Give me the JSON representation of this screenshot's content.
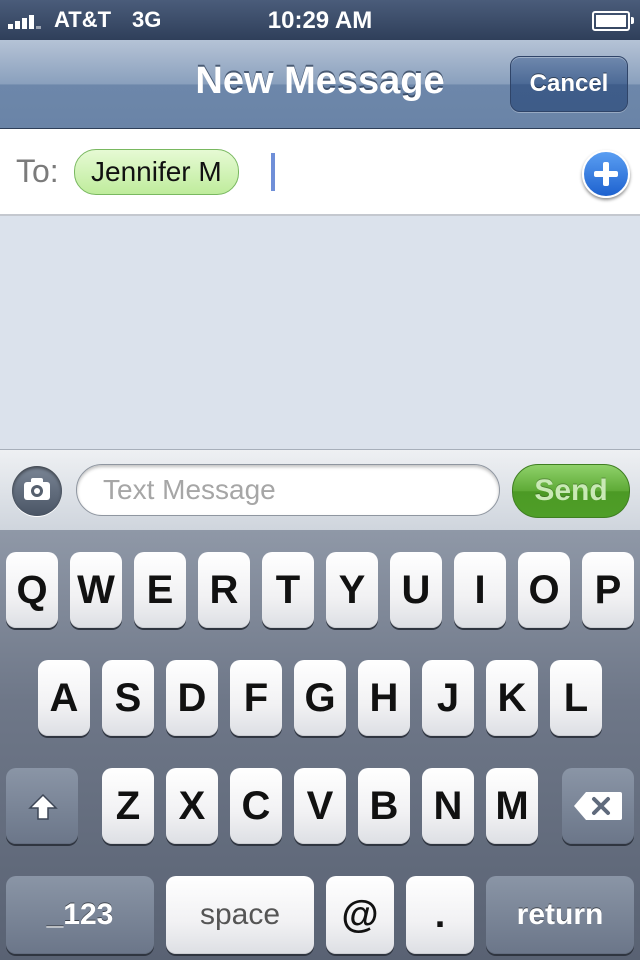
{
  "status_bar": {
    "carrier": "AT&T",
    "network": "3G",
    "time": "10:29 AM"
  },
  "nav": {
    "title": "New Message",
    "cancel_label": "Cancel"
  },
  "to_field": {
    "label": "To:",
    "recipient": "Jennifer M"
  },
  "compose": {
    "placeholder": "Text Message",
    "send_label": "Send"
  },
  "keyboard": {
    "row1": [
      "Q",
      "W",
      "E",
      "R",
      "T",
      "Y",
      "U",
      "I",
      "O",
      "P"
    ],
    "row2": [
      "A",
      "S",
      "D",
      "F",
      "G",
      "H",
      "J",
      "K",
      "L"
    ],
    "row3": [
      "Z",
      "X",
      "C",
      "V",
      "B",
      "N",
      "M"
    ],
    "numbers_label": "_123",
    "space_label": "space",
    "at_label": "@",
    "period_label": ".",
    "return_label": "return"
  },
  "colors": {
    "recipient_chip": "#c8f0a8",
    "send_button": "#5eaa36",
    "nav_bar": "#7f97b8"
  }
}
